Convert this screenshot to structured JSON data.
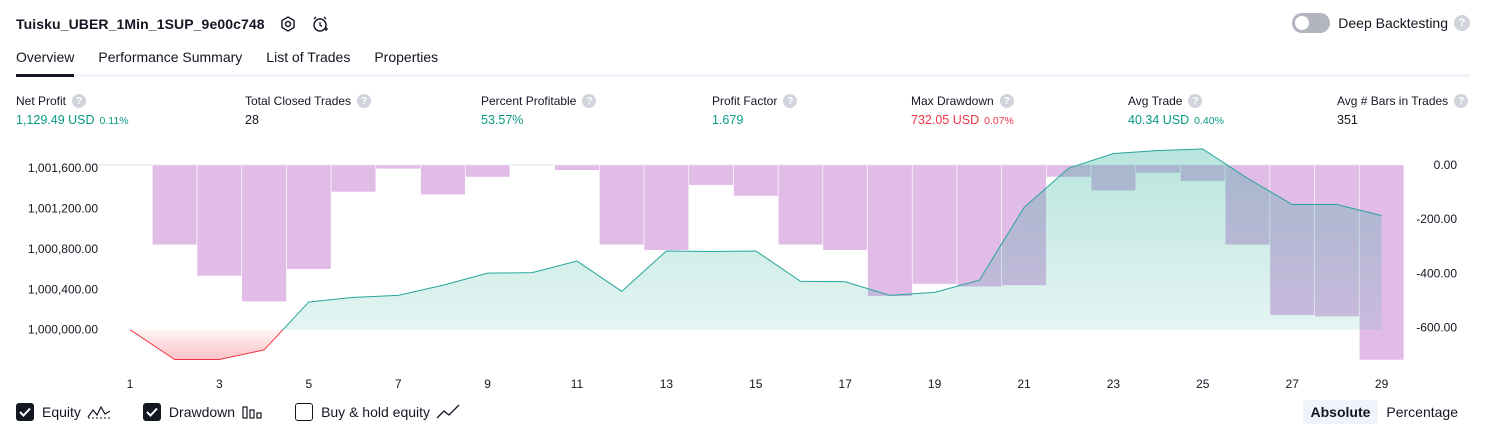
{
  "header": {
    "strategy_name": "Tuisku_UBER_1Min_1SUP_9e00c748",
    "deep_backtesting_label": "Deep Backtesting",
    "help_glyph": "?"
  },
  "icons": {
    "settings": "gear-icon",
    "alert": "alarm-clock-add-icon",
    "help": "question-icon"
  },
  "tabs": [
    {
      "label": "Overview",
      "active": true
    },
    {
      "label": "Performance Summary",
      "active": false
    },
    {
      "label": "List of Trades",
      "active": false
    },
    {
      "label": "Properties",
      "active": false
    }
  ],
  "metrics": [
    {
      "label": "Net Profit",
      "value": "1,129.49 USD",
      "pct": "0.11%",
      "color": "#089981"
    },
    {
      "label": "Total Closed Trades",
      "value": "28",
      "pct": "",
      "color": "#131722"
    },
    {
      "label": "Percent Profitable",
      "value": "53.57%",
      "pct": "",
      "color": "#089981"
    },
    {
      "label": "Profit Factor",
      "value": "1.679",
      "pct": "",
      "color": "#089981"
    },
    {
      "label": "Max Drawdown",
      "value": "732.05 USD",
      "pct": "0.07%",
      "color": "#f23645"
    },
    {
      "label": "Avg Trade",
      "value": "40.34 USD",
      "pct": "0.40%",
      "color": "#089981"
    },
    {
      "label": "Avg # Bars in Trades",
      "value": "351",
      "pct": "",
      "color": "#131722"
    }
  ],
  "chart_data": {
    "type": "area",
    "x_ticks": [
      1,
      3,
      5,
      7,
      9,
      11,
      13,
      15,
      17,
      19,
      21,
      23,
      25,
      27,
      29
    ],
    "xlim": [
      0,
      29
    ],
    "left_axis": {
      "ticks": [
        "1,000,000.00",
        "1,000,400.00",
        "1,000,800.00",
        "1,001,200.00",
        "1,001,600.00"
      ],
      "ylim": [
        999700,
        1001780
      ]
    },
    "right_axis": {
      "ticks": [
        "0.00",
        "-200.00",
        "-400.00",
        "-600.00"
      ],
      "ylim": [
        -720,
        55
      ]
    },
    "series": [
      {
        "name": "Equity",
        "x": [
          1,
          2,
          3,
          4,
          5,
          6,
          7,
          8,
          9,
          10,
          11,
          12,
          13,
          14,
          15,
          16,
          17,
          18,
          19,
          20,
          21,
          22,
          23,
          24,
          25,
          26,
          27,
          28,
          29
        ],
        "values": [
          1000000,
          999705,
          999705,
          999800,
          1000275,
          1000320,
          1000340,
          1000440,
          1000560,
          1000565,
          1000680,
          1000380,
          1000780,
          1000775,
          1000780,
          1000480,
          1000475,
          1000340,
          1000370,
          1000490,
          1001210,
          1001600,
          1001745,
          1001775,
          1001790,
          1001500,
          1001240,
          1001240,
          1001130
        ]
      },
      {
        "name": "Drawdown",
        "x": [
          1,
          2,
          3,
          4,
          5,
          6,
          7,
          8,
          9,
          10,
          11,
          12,
          13,
          14,
          15,
          16,
          17,
          18,
          19,
          20,
          21,
          22,
          23,
          24,
          25,
          26,
          27,
          28,
          29
        ],
        "values": [
          0,
          -295,
          -410,
          -505,
          -385,
          -100,
          -15,
          -110,
          -45,
          0,
          -20,
          -295,
          -315,
          -75,
          -115,
          -295,
          -315,
          -485,
          -440,
          -450,
          -445,
          -45,
          -95,
          -30,
          -60,
          -295,
          -555,
          -560,
          -720
        ]
      }
    ],
    "colors": {
      "equity_line": "#26a69a",
      "equity_fill": "#22ab94",
      "equity_negative": "#f23645",
      "drawdown_bar": "#ce93d8",
      "axis_text": "#131722"
    },
    "grid": false
  },
  "legend": {
    "items": [
      {
        "label": "Equity",
        "checked": true,
        "icon": "equity-line-icon"
      },
      {
        "label": "Drawdown",
        "checked": true,
        "icon": "drawdown-bars-icon"
      },
      {
        "label": "Buy & hold equity",
        "checked": false,
        "icon": "buy-hold-line-icon"
      }
    ]
  },
  "scale_toggle": {
    "absolute": "Absolute",
    "percentage": "Percentage",
    "selected": "Absolute"
  }
}
